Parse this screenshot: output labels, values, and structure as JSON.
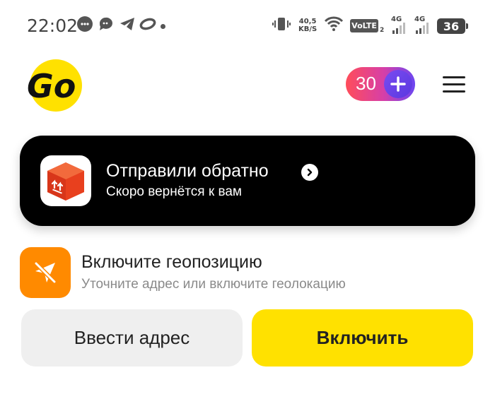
{
  "status_bar": {
    "time": "22:02",
    "speed_value": "40,5",
    "speed_unit": "KB/S",
    "volte": "VoLTE",
    "volte_sub": "2",
    "net1": "4G",
    "net2": "4G",
    "battery": "36",
    "icons": [
      "chat-bubble-icon",
      "message-icon",
      "telegram-icon",
      "oval-app-icon",
      "vibrate-icon",
      "wifi-icon",
      "signal-icon"
    ]
  },
  "header": {
    "logo_text": "Go",
    "plus_points": "30",
    "plus_icon": "plus-icon",
    "menu_icon": "hamburger-menu-icon"
  },
  "delivery": {
    "title": "Отправили обратно",
    "subtitle": "Скоро вернётся к вам",
    "icon": "package-box-icon",
    "arrow_icon": "chevron-right-icon"
  },
  "geo": {
    "title": "Включите геопозицию",
    "subtitle": "Уточните адрес или включите геолокацию",
    "icon": "location-off-icon"
  },
  "buttons": {
    "enter_address": "Ввести адрес",
    "enable": "Включить"
  },
  "colors": {
    "brand_yellow": "#FFE100",
    "geo_orange": "#FF8A00",
    "box_red": "#E8401E",
    "card_bg": "#000000"
  }
}
